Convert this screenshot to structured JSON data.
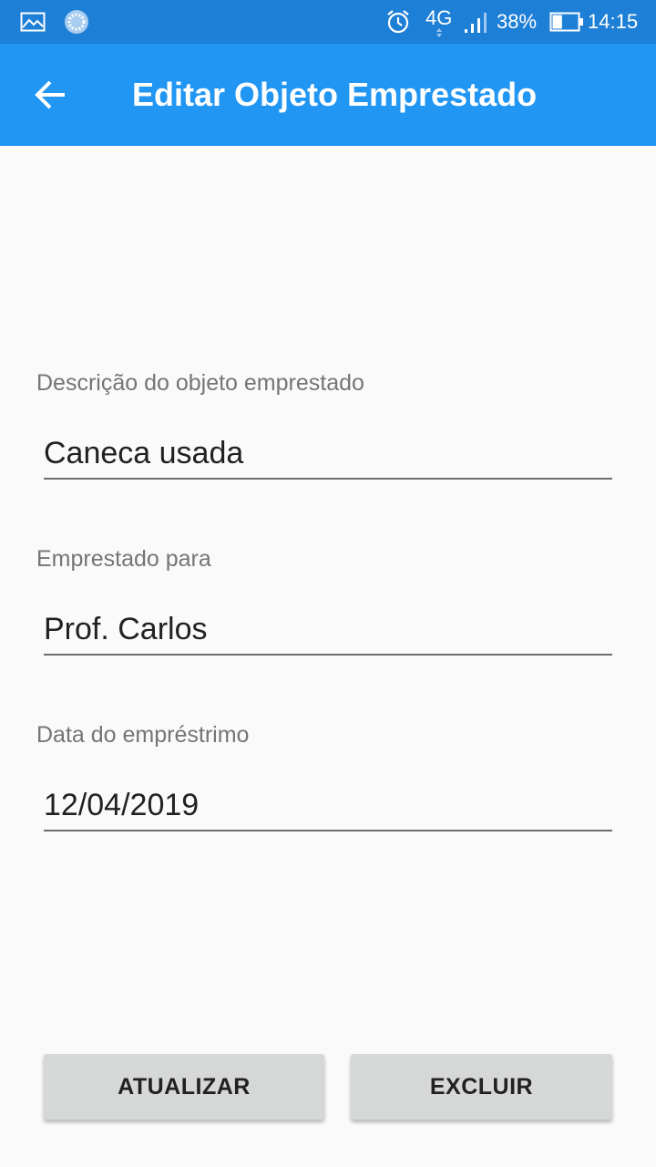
{
  "status_bar": {
    "network": "4G",
    "battery_percent": "38%",
    "battery_level": 0.38,
    "time": "14:15",
    "icons": [
      "image-notification-icon",
      "sync-notification-icon",
      "alarm-icon",
      "network-4g-icon",
      "signal-icon",
      "battery-icon"
    ]
  },
  "app_bar": {
    "title": "Editar Objeto Emprestado",
    "back_icon": "arrow-back-icon"
  },
  "form": {
    "description": {
      "label": "Descrição do objeto emprestado",
      "value": "Caneca usada"
    },
    "borrower": {
      "label": "Emprestado para",
      "value": "Prof. Carlos"
    },
    "loan_date": {
      "label": "Data do empréstrimo",
      "value": "12/04/2019"
    }
  },
  "actions": {
    "update_label": "ATUALIZAR",
    "delete_label": "EXCLUIR"
  },
  "colors": {
    "status_bar": "#1e7fd6",
    "app_bar": "#2196f3",
    "background": "#fafafa",
    "button": "#d6d7d7"
  }
}
